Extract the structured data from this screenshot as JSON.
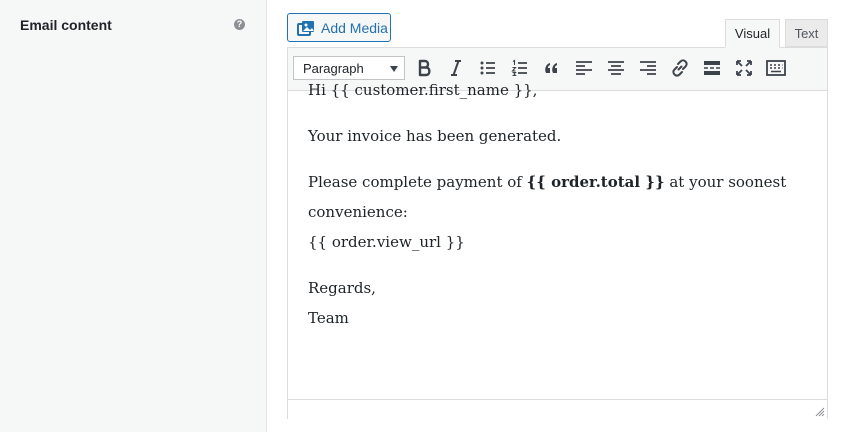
{
  "field": {
    "label": "Email content",
    "help_icon": "?"
  },
  "media": {
    "add_label": "Add Media"
  },
  "tabs": {
    "visual": "Visual",
    "text": "Text"
  },
  "toolbar": {
    "format_value": "Paragraph",
    "icons": [
      "bold-icon",
      "italic-icon",
      "bullet-list-icon",
      "numbered-list-icon",
      "blockquote-icon",
      "align-left-icon",
      "align-center-icon",
      "align-right-icon",
      "link-icon",
      "read-more-icon",
      "fullscreen-icon",
      "toolbar-toggle-icon"
    ]
  },
  "content": {
    "greeting": "Hi {{ customer.first_name }},",
    "line1": "Your invoice has been generated.",
    "pay_prefix": "Please complete payment of ",
    "pay_bold": "{{ order.total }}",
    "pay_suffix": " at your soonest convenience:",
    "url": "{{ order.view_url }}",
    "regards": "Regards,",
    "team": "Team"
  },
  "colors": {
    "accent": "#2271b1",
    "text": "#1d2327",
    "icon": "#3c434a",
    "border": "#dcdcde"
  }
}
